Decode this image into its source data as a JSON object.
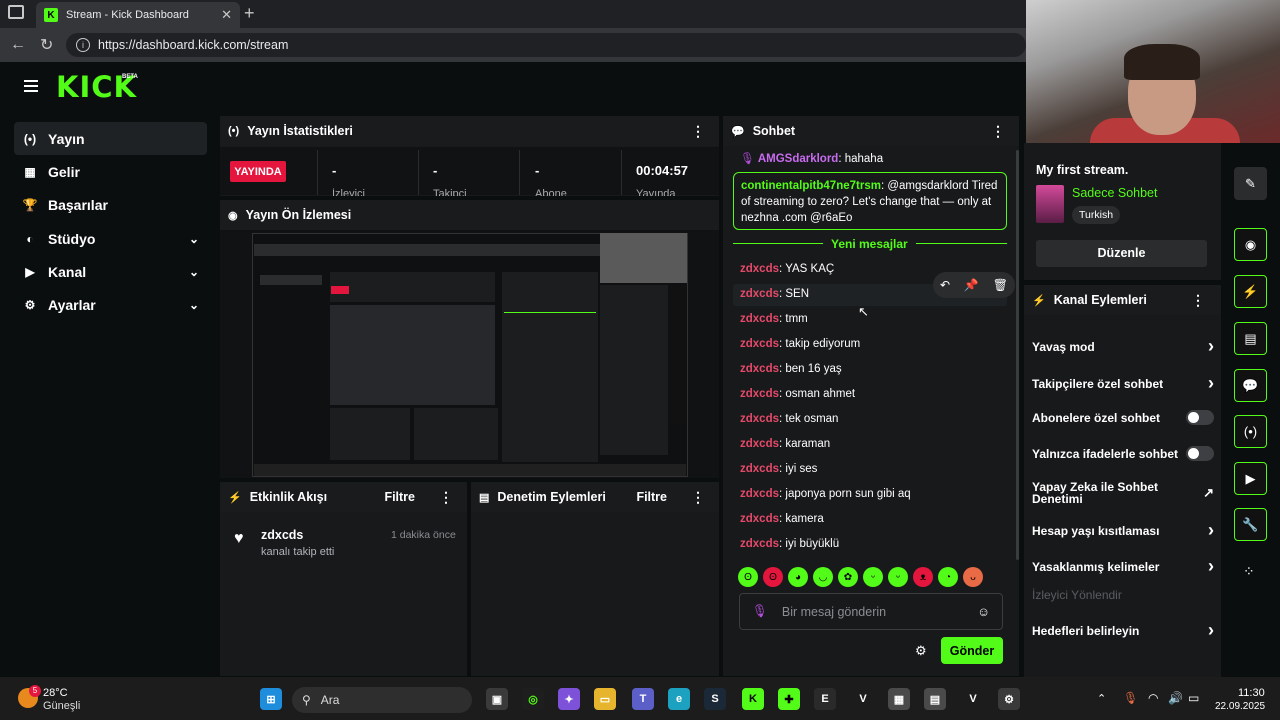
{
  "browser": {
    "tab_title": "Stream - Kick Dashboard",
    "tab_close": "✕",
    "new_tab": "+",
    "url": "https://dashboard.kick.com/stream"
  },
  "sidebar": {
    "logo": "KICK",
    "beta": "BETA",
    "items": [
      {
        "label": "Yayın",
        "icon": "(•)"
      },
      {
        "label": "Gelir",
        "icon": "▦"
      },
      {
        "label": "Başarılar",
        "icon": "🏆"
      },
      {
        "label": "Stüdyo",
        "icon": "◐"
      },
      {
        "label": "Kanal",
        "icon": "▶"
      },
      {
        "label": "Ayarlar",
        "icon": "⚙"
      }
    ]
  },
  "stats": {
    "title": "Yayın İstatistikleri",
    "live": "YAYINDA",
    "cols": [
      {
        "value": "-",
        "label": "İzleyici"
      },
      {
        "value": "-",
        "label": "Takipçi"
      },
      {
        "value": "-",
        "label": "Abone"
      }
    ],
    "timer": "00:04:57",
    "timer_label": "Yayında"
  },
  "preview": {
    "title": "Yayın Ön İzlemesi"
  },
  "activity": {
    "title": "Etkinlik Akışı",
    "filter": "Filtre",
    "item_user": "zdxcds",
    "item_text": "kanalı takip etti",
    "item_time": "1 dakika önce"
  },
  "moderation": {
    "title": "Denetim Eylemleri",
    "filter": "Filtre"
  },
  "chat": {
    "title": "Sohbet",
    "first_user": "AMGSdarklord",
    "first_text": "hahaha",
    "highlight_user": "continentalpitb47ne7trsm",
    "highlight_text": "@amgsdarklord Tired of streaming to zero? Let's change that — only at nezhna .com @r6aEo",
    "new_messages": "Yeni mesajlar",
    "messages": [
      {
        "user": "zdxcds",
        "text": "YAS KAÇ"
      },
      {
        "user": "zdxcds",
        "text": "SEN"
      },
      {
        "user": "zdxcds",
        "text": "tmm"
      },
      {
        "user": "zdxcds",
        "text": "takip ediyorum"
      },
      {
        "user": "zdxcds",
        "text": "ben 16 yaş"
      },
      {
        "user": "zdxcds",
        "text": "osman ahmet"
      },
      {
        "user": "zdxcds",
        "text": "tek osman"
      },
      {
        "user": "zdxcds",
        "text": "karaman"
      },
      {
        "user": "zdxcds",
        "text": "iyi ses"
      },
      {
        "user": "zdxcds",
        "text": "japonya porn sun gibi aq"
      },
      {
        "user": "zdxcds",
        "text": "kamera"
      },
      {
        "user": "zdxcds",
        "text": "iyi büyüklü"
      }
    ],
    "placeholder": "Bir mesaj gönderin",
    "send": "Gönder"
  },
  "stream_info": {
    "title": "My first stream.",
    "category": "Sadece Sohbet",
    "language": "Turkish",
    "edit": "Düzenle"
  },
  "channel_actions": {
    "title": "Kanal Eylemleri",
    "items": [
      {
        "label": "Yavaş mod",
        "kind": "chevron"
      },
      {
        "label": "Takipçilere özel sohbet",
        "kind": "chevron"
      },
      {
        "label": "Abonelere özel sohbet",
        "kind": "toggle"
      },
      {
        "label": "Yalnızca ifadelerle sohbet",
        "kind": "toggle"
      },
      {
        "label": "Yapay Zeka ile Sohbet Denetimi",
        "kind": "external"
      },
      {
        "label": "Hesap yaşı kısıtlaması",
        "kind": "chevron"
      },
      {
        "label": "Yasaklanmış kelimeler",
        "kind": "chevron"
      },
      {
        "label": "İzleyici Yönlendir",
        "kind": "disabled"
      },
      {
        "label": "Hedefleri belirleyin",
        "kind": "chevron"
      }
    ]
  },
  "taskbar": {
    "weather_temp": "28°C",
    "weather_desc": "Güneşli",
    "weather_badge": "5",
    "search": "Ara",
    "time": "11:30",
    "date": "22.09.2025"
  },
  "colors": {
    "accent": "#53fc18",
    "live": "#e4163d",
    "username": "#e54a6a"
  }
}
